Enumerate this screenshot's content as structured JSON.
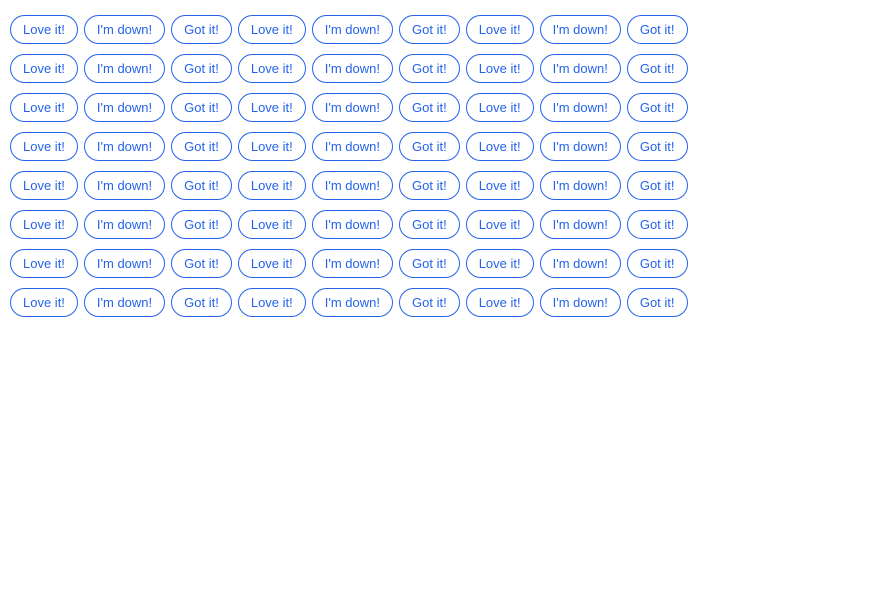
{
  "buttons": {
    "labels": [
      "Love it!",
      "I'm down!",
      "Got it!"
    ],
    "colors": {
      "border": "#2563eb",
      "text": "#2563eb",
      "background": "#ffffff"
    }
  },
  "grid": {
    "rows": 8,
    "cols": 9,
    "pattern": [
      "Love it!",
      "I'm down!",
      "Got it!",
      "Love it!",
      "I'm down!",
      "Got it!",
      "Love it!",
      "I'm down!",
      "Got it!"
    ]
  }
}
